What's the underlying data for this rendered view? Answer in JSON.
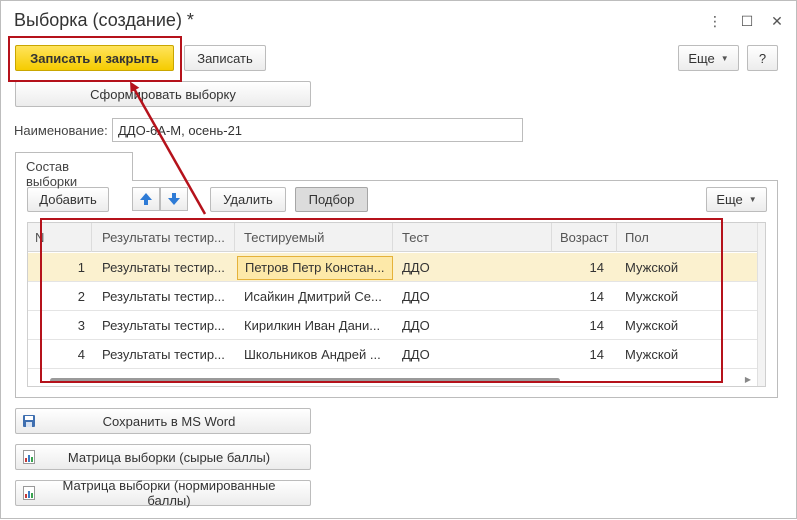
{
  "window": {
    "title": "Выборка (создание) *",
    "controls": [
      "more-vert",
      "maximize",
      "close"
    ]
  },
  "toolbar": {
    "save_close_label": "Записать и закрыть",
    "save_label": "Записать",
    "more_label": "Еще",
    "help_label": "?"
  },
  "form": {
    "generate_label": "Сформировать выборку",
    "name_label": "Наименование:",
    "name_value": "ДДО-6А-М, осень-21"
  },
  "tab": {
    "label": "Состав выборки",
    "add_label": "Добавить",
    "delete_label": "Удалить",
    "pick_label": "Подбор",
    "more_label": "Еще"
  },
  "table": {
    "columns": [
      "N",
      "Результаты тестир...",
      "Тестируемый",
      "Тест",
      "Возраст",
      "Пол"
    ],
    "rows": [
      {
        "n": "1",
        "result": "Результаты тестир...",
        "person": "Петров Петр Констан...",
        "test": "ДДО",
        "age": "14",
        "gender": "Мужской"
      },
      {
        "n": "2",
        "result": "Результаты тестир...",
        "person": "Исайкин Дмитрий Се...",
        "test": "ДДО",
        "age": "14",
        "gender": "Мужской"
      },
      {
        "n": "3",
        "result": "Результаты тестир...",
        "person": "Кирилкин Иван Дани...",
        "test": "ДДО",
        "age": "14",
        "gender": "Мужской"
      },
      {
        "n": "4",
        "result": "Результаты тестир...",
        "person": "Школьников Андрей ...",
        "test": "ДДО",
        "age": "14",
        "gender": "Мужской"
      }
    ]
  },
  "bottom": {
    "word_label": "Сохранить в MS Word",
    "matrix_raw_label": "Матрица выборки (сырые баллы)",
    "matrix_norm_label": "Матрица выборки (нормированные баллы)"
  },
  "colors": {
    "primary": "#f5cc00",
    "highlight": "#b5121b",
    "selected_row": "#fbf1cf",
    "arrow_blue": "#2e7bd6"
  },
  "icons": {
    "up": "arrow-up-icon",
    "down": "arrow-down-icon",
    "save": "floppy-icon",
    "matrix": "matrix-icon"
  }
}
